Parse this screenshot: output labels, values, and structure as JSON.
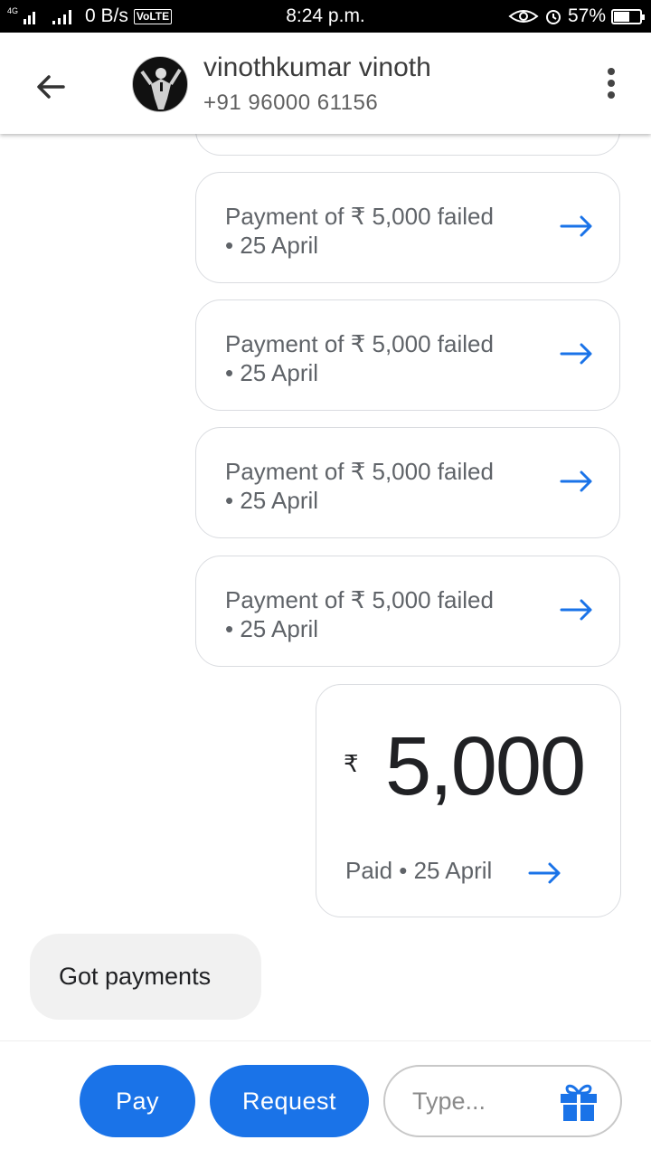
{
  "status_bar": {
    "network": "4G",
    "speed": "0 B/s",
    "volte": "VoLTE",
    "time": "8:24 p.m.",
    "battery": "57%",
    "battery_level": 0.57
  },
  "header": {
    "contact_name": "vinothkumar vinoth",
    "contact_phone": "+91 96000 61156"
  },
  "messages": {
    "failed": [
      {
        "line1": "Payment of ₹ 5,000 failed",
        "line2": "• 25 April"
      },
      {
        "line1": "Payment of ₹ 5,000 failed",
        "line2": "• 25 April"
      },
      {
        "line1": "Payment of ₹ 5,000 failed",
        "line2": "• 25 April"
      },
      {
        "line1": "Payment of ₹ 5,000 failed",
        "line2": "• 25 April"
      }
    ],
    "paid": {
      "currency": "₹",
      "amount": "5,000",
      "status": "Paid • 25 April"
    },
    "incoming_text": "Got payments"
  },
  "bottom_bar": {
    "pay_label": "Pay",
    "request_label": "Request",
    "input_placeholder": "Type..."
  },
  "colors": {
    "accent": "#1a73e8",
    "card_border": "#dadce0",
    "incoming_bg": "#f1f1f1"
  }
}
